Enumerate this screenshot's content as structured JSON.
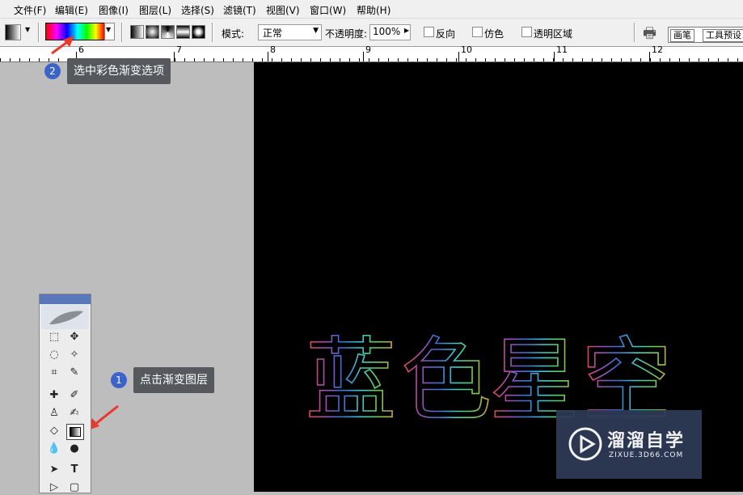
{
  "menu": [
    "文件(F)",
    "编辑(E)",
    "图像(I)",
    "图层(L)",
    "选择(S)",
    "滤镜(T)",
    "视图(V)",
    "窗口(W)",
    "帮助(H)"
  ],
  "options": {
    "mode_label": "模式:",
    "mode_value": "正常",
    "opacity_label": "不透明度:",
    "opacity_value": "100%",
    "reverse_label": "反向",
    "dither_label": "仿色",
    "transparency_label": "透明区域",
    "tab_brush": "画笔",
    "tab_presets": "工具预设"
  },
  "ruler": [
    "6",
    "7",
    "8",
    "9",
    "10",
    "11",
    "12"
  ],
  "callouts": {
    "step1_num": "1",
    "step1_text": "点击渐变图层",
    "step2_num": "2",
    "step2_text": "选中彩色渐变选项"
  },
  "canvas_text": [
    "蓝",
    "色",
    "星",
    "空"
  ],
  "watermark": {
    "title": "溜溜自学",
    "url": "ZIXUE.3D66.COM"
  },
  "colors": {
    "canvas": "#000000",
    "workspace": "#bdbdbd",
    "callout_bg": "#55595e",
    "badge": "#3b63c9",
    "arrow": "#e8392f"
  },
  "icons": {
    "tool_icon": "gradient-icon",
    "tool_preset": "tool-preset-icon"
  }
}
